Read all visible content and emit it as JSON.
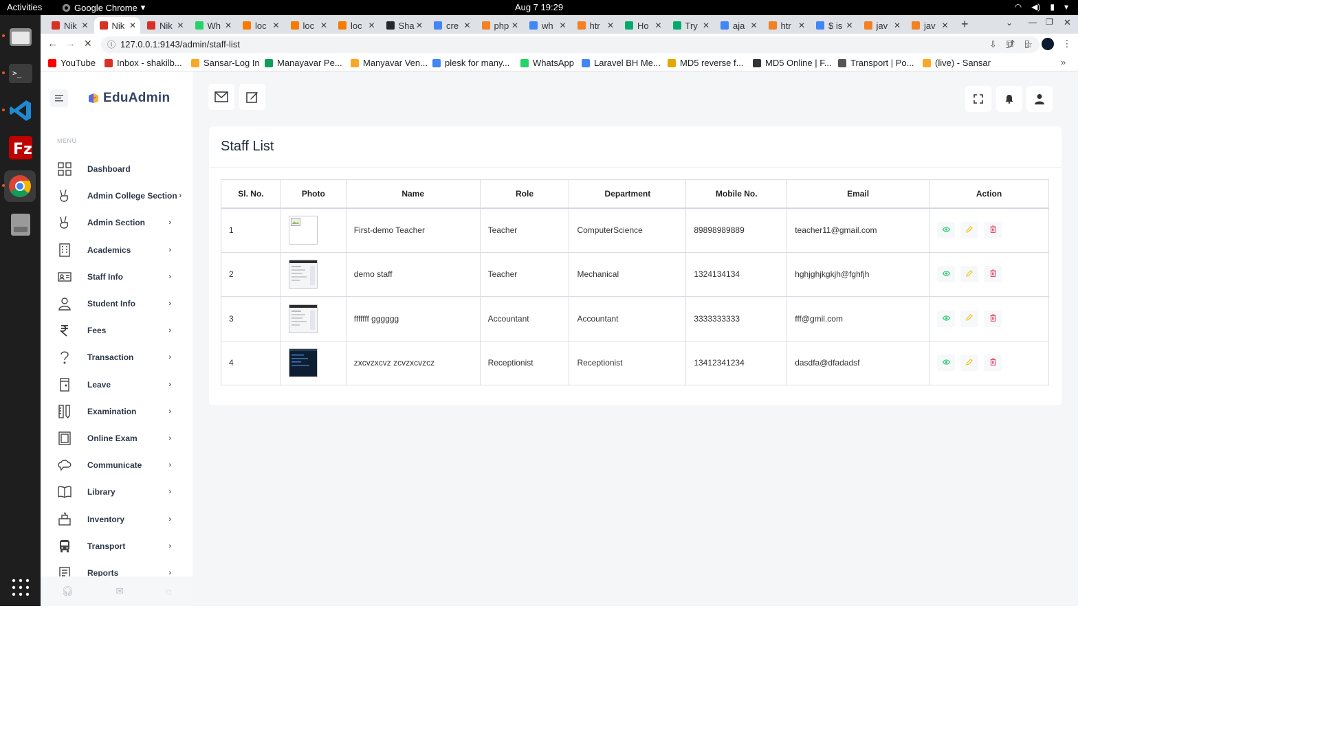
{
  "os": {
    "activities": "Activities",
    "app_name": "Google Chrome",
    "datetime": "Aug 7  19:29",
    "dock": [
      "files",
      "terminal",
      "vscode",
      "filezilla",
      "chrome",
      "drive"
    ]
  },
  "browser": {
    "tabs": [
      {
        "label": "Nik",
        "icon": "gmail-icon",
        "color": "#d93025"
      },
      {
        "label": "Nik",
        "icon": "gmail-icon",
        "color": "#d93025",
        "active": true
      },
      {
        "label": "Nik",
        "icon": "gmail-icon",
        "color": "#d93025"
      },
      {
        "label": "Wh",
        "icon": "whatsapp-icon",
        "color": "#25d366"
      },
      {
        "label": "loc",
        "icon": "chart-icon",
        "color": "#f57c00"
      },
      {
        "label": "loc",
        "icon": "chart-icon",
        "color": "#f57c00"
      },
      {
        "label": "loc",
        "icon": "chart-icon",
        "color": "#f57c00"
      },
      {
        "label": "Sha",
        "icon": "github-icon",
        "color": "#24292e"
      },
      {
        "label": "cre",
        "icon": "google-icon",
        "color": "#4285f4"
      },
      {
        "label": "php",
        "icon": "stackoverflow-icon",
        "color": "#f48024"
      },
      {
        "label": "wh",
        "icon": "google-icon",
        "color": "#4285f4"
      },
      {
        "label": "htr",
        "icon": "stackoverflow-icon",
        "color": "#f48024"
      },
      {
        "label": "Ho",
        "icon": "w3schools-icon",
        "color": "#04aa6d"
      },
      {
        "label": "Try",
        "icon": "w3schools-icon",
        "color": "#04aa6d"
      },
      {
        "label": "aja",
        "icon": "google-icon",
        "color": "#4285f4"
      },
      {
        "label": "htr",
        "icon": "stackoverflow-icon",
        "color": "#f48024"
      },
      {
        "label": "$ is",
        "icon": "google-icon",
        "color": "#4285f4"
      },
      {
        "label": "jav",
        "icon": "stackoverflow-icon",
        "color": "#f48024"
      },
      {
        "label": "jav",
        "icon": "stackoverflow-icon",
        "color": "#f48024"
      }
    ],
    "url": "127.0.0.1:9143/admin/staff-list",
    "bookmarks": [
      {
        "label": "YouTube",
        "color": "#ff0000"
      },
      {
        "label": "Inbox - shakilb...",
        "color": "#d93025"
      },
      {
        "label": "Sansar-Log In",
        "color": "#f9a825"
      },
      {
        "label": "Manayavar Pe...",
        "color": "#0f9d58"
      },
      {
        "label": "Manyavar Ven...",
        "color": "#f9a825"
      },
      {
        "label": "plesk for many...",
        "color": "#4285f4"
      },
      {
        "label": "WhatsApp",
        "color": "#25d366"
      },
      {
        "label": "Laravel BH Me...",
        "color": "#4285f4"
      },
      {
        "label": "MD5 reverse f...",
        "color": "#e0a800"
      },
      {
        "label": "MD5 Online | F...",
        "color": "#333333"
      },
      {
        "label": "Transport | Po...",
        "color": "#555555"
      },
      {
        "label": "(live) - Sansar",
        "color": "#f9a825"
      }
    ]
  },
  "app": {
    "brand": "EduAdmin",
    "menu_label": "MENU",
    "nav": [
      {
        "label": "Dashboard",
        "icon": "grid-icon",
        "chevron": false
      },
      {
        "label": "Admin College Section",
        "icon": "peace-hand-icon",
        "chevron": true
      },
      {
        "label": "Admin Section",
        "icon": "peace-hand-icon",
        "chevron": true
      },
      {
        "label": "Academics",
        "icon": "building-icon",
        "chevron": true
      },
      {
        "label": "Staff Info",
        "icon": "id-card-icon",
        "chevron": true
      },
      {
        "label": "Student Info",
        "icon": "user-icon",
        "chevron": true
      },
      {
        "label": "Fees",
        "icon": "rupee-icon",
        "chevron": true
      },
      {
        "label": "Transaction",
        "icon": "question-icon",
        "chevron": true
      },
      {
        "label": "Leave",
        "icon": "door-icon",
        "chevron": true
      },
      {
        "label": "Examination",
        "icon": "pencil-ruler-icon",
        "chevron": true
      },
      {
        "label": "Online Exam",
        "icon": "monitor-icon",
        "chevron": true
      },
      {
        "label": "Communicate",
        "icon": "chat-cloud-icon",
        "chevron": true
      },
      {
        "label": "Library",
        "icon": "book-icon",
        "chevron": true
      },
      {
        "label": "Inventory",
        "icon": "box-icon",
        "chevron": true
      },
      {
        "label": "Transport",
        "icon": "bus-icon",
        "chevron": true
      },
      {
        "label": "Reports",
        "icon": "report-icon",
        "chevron": true
      }
    ],
    "page_title": "Staff List",
    "table": {
      "headers": [
        "Sl. No.",
        "Photo",
        "Name",
        "Role",
        "Department",
        "Mobile No.",
        "Email",
        "Action"
      ],
      "rows": [
        {
          "sl": "1",
          "photo": "broken",
          "name": "First-demo Teacher",
          "role": "Teacher",
          "department": "ComputerScience",
          "mobile": "89898989889",
          "email": "teacher11@gmail.com"
        },
        {
          "sl": "2",
          "photo": "doc",
          "name": "demo staff",
          "role": "Teacher",
          "department": "Mechanical",
          "mobile": "1324134134",
          "email": "hghjghjkgkjh@fghfjh"
        },
        {
          "sl": "3",
          "photo": "doc",
          "name": "fffffff gggggg",
          "role": "Accountant",
          "department": "Accountant",
          "mobile": "3333333333",
          "email": "fff@gmil.com"
        },
        {
          "sl": "4",
          "photo": "dark",
          "name": "zxcvzxcvz zcvzxcvzcz",
          "role": "Receptionist",
          "department": "Receptionist",
          "mobile": "13412341234",
          "email": "dasdfa@dfadadsf"
        }
      ]
    },
    "colors": {
      "view": "#2ecc71",
      "edit": "#f1c40f",
      "delete": "#e74c6c"
    }
  }
}
